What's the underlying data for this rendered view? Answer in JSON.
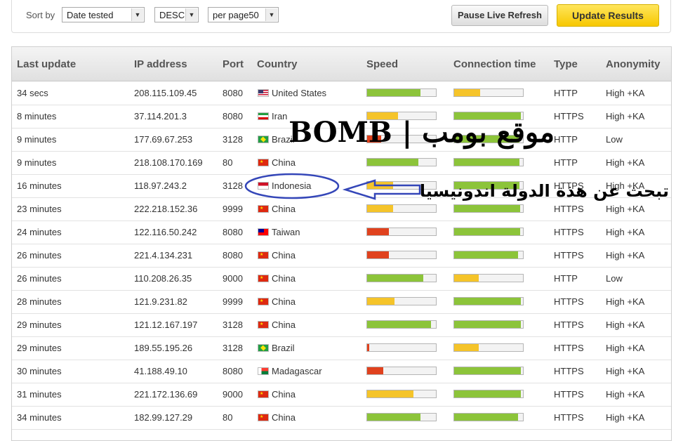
{
  "controls": {
    "sort_label": "Sort by",
    "sort_value": "Date tested",
    "order_value": "DESC",
    "perpage_value": "per page50",
    "pause_label": "Pause Live Refresh",
    "update_label": "Update Results"
  },
  "table": {
    "headers": [
      "Last update",
      "IP address",
      "Port",
      "Country",
      "Speed",
      "Connection time",
      "Type",
      "Anonymity"
    ],
    "rows": [
      {
        "last": "34 secs",
        "ip": "208.115.109.45",
        "port": "8080",
        "country": "United States",
        "flag": "us",
        "speed": 0.78,
        "speed_color": "green",
        "conn": 0.38,
        "conn_color": "yellow",
        "type": "HTTP",
        "anon": "High +KA"
      },
      {
        "last": "8 minutes",
        "ip": "37.114.201.3",
        "port": "8080",
        "country": "Iran",
        "flag": "ir",
        "speed": 0.45,
        "speed_color": "yellow",
        "conn": 0.97,
        "conn_color": "green",
        "type": "HTTPS",
        "anon": "High +KA"
      },
      {
        "last": "9 minutes",
        "ip": "177.69.67.253",
        "port": "3128",
        "country": "Brazil",
        "flag": "br",
        "speed": 0.2,
        "speed_color": "red",
        "conn": 0.95,
        "conn_color": "green",
        "type": "HTTP",
        "anon": "Low"
      },
      {
        "last": "9 minutes",
        "ip": "218.108.170.169",
        "port": "80",
        "country": "China",
        "flag": "cn",
        "speed": 0.74,
        "speed_color": "green",
        "conn": 0.95,
        "conn_color": "green",
        "type": "HTTP",
        "anon": "High +KA"
      },
      {
        "last": "16 minutes",
        "ip": "118.97.243.2",
        "port": "3128",
        "country": "Indonesia",
        "flag": "id",
        "speed": 0.38,
        "speed_color": "yellow",
        "conn": 0.95,
        "conn_color": "green",
        "type": "HTTPS",
        "anon": "High +KA"
      },
      {
        "last": "23 minutes",
        "ip": "222.218.152.36",
        "port": "9999",
        "country": "China",
        "flag": "cn",
        "speed": 0.38,
        "speed_color": "yellow",
        "conn": 0.96,
        "conn_color": "green",
        "type": "HTTPS",
        "anon": "High +KA"
      },
      {
        "last": "24 minutes",
        "ip": "122.116.50.242",
        "port": "8080",
        "country": "Taiwan",
        "flag": "tw",
        "speed": 0.32,
        "speed_color": "red",
        "conn": 0.96,
        "conn_color": "green",
        "type": "HTTPS",
        "anon": "High +KA"
      },
      {
        "last": "26 minutes",
        "ip": "221.4.134.231",
        "port": "8080",
        "country": "China",
        "flag": "cn",
        "speed": 0.32,
        "speed_color": "red",
        "conn": 0.93,
        "conn_color": "green",
        "type": "HTTPS",
        "anon": "High +KA"
      },
      {
        "last": "26 minutes",
        "ip": "110.208.26.35",
        "port": "9000",
        "country": "China",
        "flag": "cn",
        "speed": 0.82,
        "speed_color": "green",
        "conn": 0.36,
        "conn_color": "yellow",
        "type": "HTTP",
        "anon": "Low"
      },
      {
        "last": "28 minutes",
        "ip": "121.9.231.82",
        "port": "9999",
        "country": "China",
        "flag": "cn",
        "speed": 0.4,
        "speed_color": "yellow",
        "conn": 0.97,
        "conn_color": "green",
        "type": "HTTPS",
        "anon": "High +KA"
      },
      {
        "last": "29 minutes",
        "ip": "121.12.167.197",
        "port": "3128",
        "country": "China",
        "flag": "cn",
        "speed": 0.93,
        "speed_color": "green",
        "conn": 0.97,
        "conn_color": "green",
        "type": "HTTPS",
        "anon": "High +KA"
      },
      {
        "last": "29 minutes",
        "ip": "189.55.195.26",
        "port": "3128",
        "country": "Brazil",
        "flag": "br",
        "speed": 0.03,
        "speed_color": "red",
        "conn": 0.36,
        "conn_color": "yellow",
        "type": "HTTPS",
        "anon": "High +KA"
      },
      {
        "last": "30 minutes",
        "ip": "41.188.49.10",
        "port": "8080",
        "country": "Madagascar",
        "flag": "mg",
        "speed": 0.23,
        "speed_color": "red",
        "conn": 0.97,
        "conn_color": "green",
        "type": "HTTPS",
        "anon": "High +KA"
      },
      {
        "last": "31 minutes",
        "ip": "221.172.136.69",
        "port": "9000",
        "country": "China",
        "flag": "cn",
        "speed": 0.67,
        "speed_color": "yellow",
        "conn": 0.97,
        "conn_color": "green",
        "type": "HTTPS",
        "anon": "High +KA"
      },
      {
        "last": "34 minutes",
        "ip": "182.99.127.29",
        "port": "80",
        "country": "China",
        "flag": "cn",
        "speed": 0.78,
        "speed_color": "green",
        "conn": 0.93,
        "conn_color": "green",
        "type": "HTTPS",
        "anon": "High +KA"
      }
    ]
  },
  "annotations": {
    "bomb_text": "موقع بومب | BOMB",
    "search_text": "تبحث عن هذة الدولة اندونيسيا"
  },
  "colors": {
    "green": "#8cc43a",
    "yellow": "#f5c42a",
    "red": "#e0421e",
    "annotation_blue": "#3446b8"
  }
}
